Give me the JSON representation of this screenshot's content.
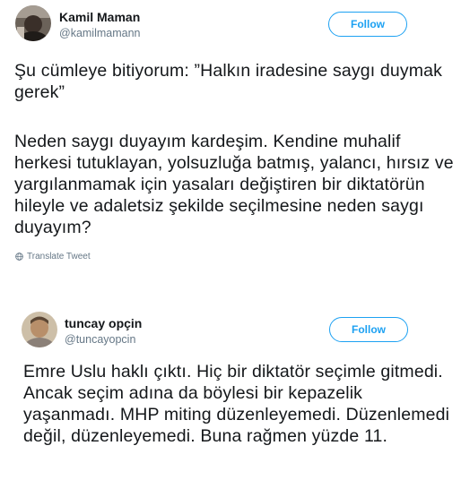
{
  "tweets": [
    {
      "name": "Kamil Maman",
      "handle": "@kamilmamann",
      "follow_label": "Follow",
      "paragraphs": [
        "Şu cümleye bitiyorum: ”Halkın iradesine saygı duymak gerek”",
        "Neden saygı duyayım kardeşim. Kendine muhalif herkesi tutuklayan, yolsuzluğa batmış, yalancı, hırsız ve yargılanmamak için yasaları değiştiren bir diktatörün hileyle ve adaletsiz şekilde seçilmesine neden saygı duyayım?"
      ],
      "translate_label": "Translate Tweet"
    },
    {
      "name": "tuncay opçin",
      "handle": "@tuncayopcin",
      "follow_label": "Follow",
      "paragraphs": [
        "Emre Uslu haklı çıktı. Hiç bir diktatör seçimle gitmedi. Ancak seçim adına da böylesi bir kepazelik yaşanmadı. MHP miting düzenleyemedi. Düzenlemedi değil, düzenleyemedi. Buna rağmen yüzde 11."
      ]
    }
  ],
  "colors": {
    "accent": "#1da1f2",
    "text": "#14171a",
    "muted": "#657786"
  },
  "icons": {
    "translate": "globe-icon"
  }
}
